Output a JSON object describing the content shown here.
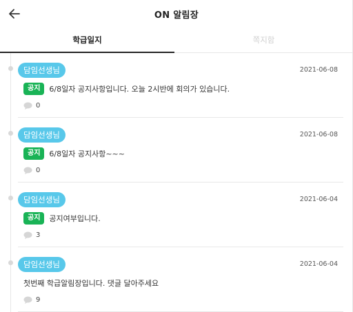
{
  "header": {
    "title": "ON 알림장",
    "back_icon": "arrow-left-icon"
  },
  "tabs": [
    {
      "label": "학급일지",
      "active": true
    },
    {
      "label": "쪽지함",
      "active": false
    }
  ],
  "posts": [
    {
      "sender": "담임선생님",
      "date": "2021-06-08",
      "badge": "공지",
      "message": "6/8일자 공지사항입니다. 오늘 2시반에 회의가 있습니다.",
      "comments": "0"
    },
    {
      "sender": "담임선생님",
      "date": "2021-06-08",
      "badge": "공지",
      "message": "6/8일자 공지사항~~~",
      "comments": "0"
    },
    {
      "sender": "담임선생님",
      "date": "2021-06-04",
      "badge": "공지",
      "message": "공지여부입니다.",
      "comments": "3"
    },
    {
      "sender": "담임선생님",
      "date": "2021-06-04",
      "badge": "",
      "message": "첫번째 학급알림장입니다. 댓글 달아주세요",
      "comments": "9"
    }
  ],
  "colors": {
    "sender_pill": "#58c8ea",
    "notice_badge": "#19b356"
  }
}
